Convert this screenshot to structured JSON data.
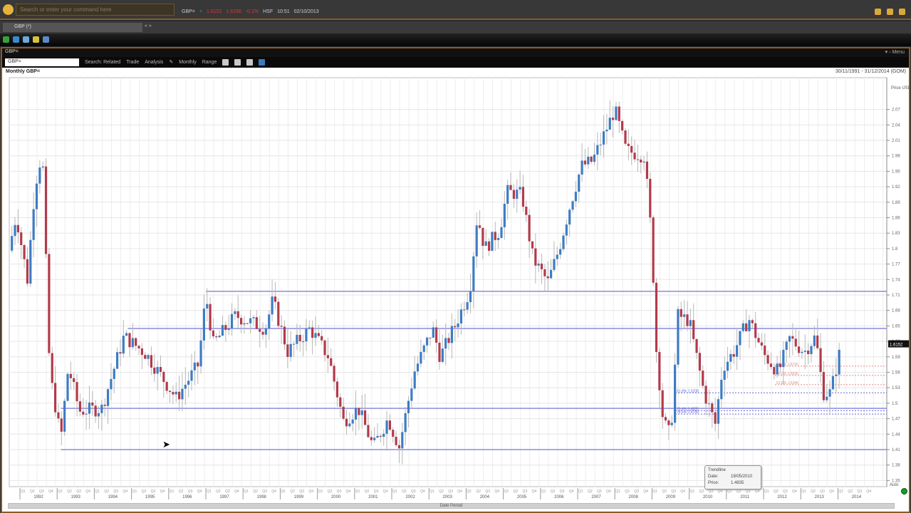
{
  "topbar": {
    "search_placeholder": "Search or enter your command here",
    "ticker": {
      "ric": "GBP=",
      "chg": "+",
      "bid": "1.6152",
      "ask": "1.6156",
      "pct": "-0.1%",
      "src": "HSF",
      "time": "10:51",
      "date": "02/10/2013"
    }
  },
  "tab": {
    "label": "GBP (*)",
    "controls": "« »"
  },
  "window": {
    "title": "GBP=",
    "controls": "▾ ▫ Menu"
  },
  "toolbar": {
    "ric_value": "GBP=",
    "search": "Search: Related",
    "trade": "Trade",
    "analysis": "Analysis",
    "interval": "Monthly",
    "range": "Range"
  },
  "chart": {
    "title": "Monthly GBP=",
    "range": "30/11/1991 - 31/12/2014 (GOM)",
    "axis_title": "Price USD",
    "last_price": "1.6152",
    "bottom_label": "Date Period",
    "auto_label": "Auto"
  },
  "tooltip": {
    "title": "Trendline",
    "date_label": "Date:",
    "date": "19/05/2010",
    "price_label": "Price:",
    "price": "1.4835"
  },
  "colors": {
    "up": "#3d7cc4",
    "down": "#b23a4a",
    "wick": "#b8b8b8",
    "hline": "#8a8ae0",
    "fib_blue": "#6a6ad8",
    "fib_red": "#e08a8a"
  },
  "chart_data": {
    "type": "candlestick",
    "title": "Monthly GBP=",
    "ylabel": "Price USD",
    "ylim": [
      1.335,
      2.11
    ],
    "yticks": [
      1.35,
      1.38,
      1.41,
      1.44,
      1.47,
      1.5,
      1.53,
      1.56,
      1.59,
      1.62,
      1.65,
      1.68,
      1.71,
      1.74,
      1.77,
      1.8,
      1.83,
      1.86,
      1.89,
      1.92,
      1.95,
      1.98,
      2.01,
      2.04,
      2.07
    ],
    "xlim": [
      1991.7,
      2014.6
    ],
    "years": [
      "1992",
      "1993",
      "1994",
      "1995",
      "1996",
      "1997",
      "1998",
      "1999",
      "2000",
      "2001",
      "2002",
      "2003",
      "2004",
      "2005",
      "2006",
      "2007",
      "2008",
      "2009",
      "2010",
      "2011",
      "2012",
      "2013",
      "2014"
    ],
    "quarters": [
      "Q1",
      "Q2",
      "Q3",
      "Q4"
    ],
    "close_path": [
      [
        1991.7,
        1.796
      ],
      [
        1991.9,
        1.865
      ],
      [
        1992.2,
        1.74
      ],
      [
        1992.4,
        1.92
      ],
      [
        1992.6,
        1.99
      ],
      [
        1992.8,
        1.56
      ],
      [
        1993.1,
        1.43
      ],
      [
        1993.3,
        1.57
      ],
      [
        1993.6,
        1.485
      ],
      [
        1994.2,
        1.49
      ],
      [
        1994.8,
        1.63
      ],
      [
        1995.4,
        1.595
      ],
      [
        1996.2,
        1.51
      ],
      [
        1996.8,
        1.575
      ],
      [
        1997.0,
        1.71
      ],
      [
        1997.2,
        1.615
      ],
      [
        1997.8,
        1.67
      ],
      [
        1998.6,
        1.645
      ],
      [
        1998.8,
        1.7
      ],
      [
        1999.2,
        1.6
      ],
      [
        1999.8,
        1.645
      ],
      [
        2000.3,
        1.59
      ],
      [
        2000.7,
        1.465
      ],
      [
        2001.1,
        1.49
      ],
      [
        2001.5,
        1.415
      ],
      [
        2001.9,
        1.47
      ],
      [
        2002.2,
        1.415
      ],
      [
        2002.6,
        1.56
      ],
      [
        2003.1,
        1.645
      ],
      [
        2003.3,
        1.59
      ],
      [
        2003.7,
        1.65
      ],
      [
        2004.1,
        1.72
      ],
      [
        2004.3,
        1.865
      ],
      [
        2004.5,
        1.8
      ],
      [
        2004.9,
        1.835
      ],
      [
        2005.1,
        1.91
      ],
      [
        2005.5,
        1.905
      ],
      [
        2005.8,
        1.78
      ],
      [
        2006.2,
        1.735
      ],
      [
        2006.5,
        1.8
      ],
      [
        2006.8,
        1.885
      ],
      [
        2007.1,
        1.96
      ],
      [
        2007.4,
        1.97
      ],
      [
        2008.0,
        2.07
      ],
      [
        2008.3,
        1.99
      ],
      [
        2008.8,
        1.98
      ],
      [
        2009.0,
        1.81
      ],
      [
        2009.1,
        1.615
      ],
      [
        2009.3,
        1.465
      ],
      [
        2009.5,
        1.436
      ],
      [
        2009.7,
        1.67
      ],
      [
        2010.0,
        1.66
      ],
      [
        2010.4,
        1.52
      ],
      [
        2010.7,
        1.46
      ],
      [
        2010.9,
        1.57
      ],
      [
        2011.2,
        1.6
      ],
      [
        2011.6,
        1.665
      ],
      [
        2012.0,
        1.595
      ],
      [
        2012.4,
        1.56
      ],
      [
        2012.7,
        1.625
      ],
      [
        2013.1,
        1.6
      ],
      [
        2013.4,
        1.63
      ],
      [
        2013.6,
        1.52
      ],
      [
        2013.8,
        1.52
      ],
      [
        2014.1,
        1.6152
      ]
    ],
    "horizontal_lines": [
      {
        "from": 1997.0,
        "price": 1.717
      },
      {
        "from": 1994.9,
        "price": 1.645
      },
      {
        "from": 1993.1,
        "price": 1.49
      },
      {
        "from": 1993.1,
        "price": 1.41
      }
    ],
    "fib_levels": [
      {
        "label": "38.2% 1.5726",
        "price": 1.572,
        "color": "red"
      },
      {
        "label": "50.0% 1.5535",
        "price": 1.554,
        "color": "red"
      },
      {
        "label": "61.8% 1.5345",
        "price": 1.536,
        "color": "red"
      },
      {
        "label": "61.8% 1.5208",
        "price": 1.52,
        "color": "blue"
      },
      {
        "label": "76.4% 1.4835",
        "price": 1.4855,
        "color": "blue"
      },
      {
        "label": "78.6% 1.4785",
        "price": 1.479,
        "color": "blue"
      }
    ]
  }
}
